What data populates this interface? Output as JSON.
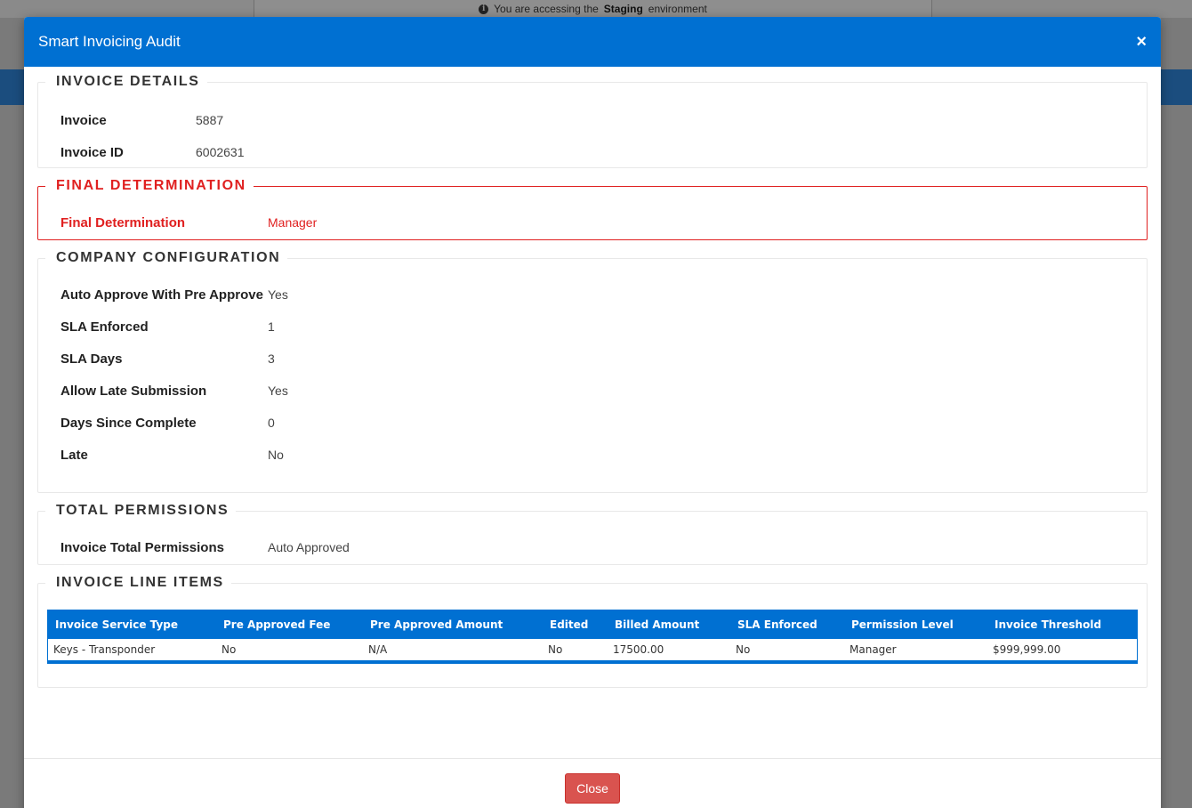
{
  "environment_banner": {
    "prefix": "You are accessing the",
    "env": "Staging",
    "suffix": "environment"
  },
  "modal": {
    "title": "Smart Invoicing Audit",
    "close_icon": "×",
    "close_button": "Close"
  },
  "invoice_details": {
    "legend": "INVOICE DETAILS",
    "rows": [
      {
        "label": "Invoice",
        "value": "5887"
      },
      {
        "label": "Invoice ID",
        "value": "6002631"
      }
    ]
  },
  "final_determination": {
    "legend": "FINAL DETERMINATION",
    "label": "Final Determination",
    "value": "Manager",
    "color": "#e02020"
  },
  "company_configuration": {
    "legend": "COMPANY CONFIGURATION",
    "rows": [
      {
        "label": "Auto Approve With Pre Approve",
        "value": "Yes"
      },
      {
        "label": "SLA Enforced",
        "value": "1"
      },
      {
        "label": "SLA Days",
        "value": "3"
      },
      {
        "label": "Allow Late Submission",
        "value": "Yes"
      },
      {
        "label": "Days Since Complete",
        "value": "0"
      },
      {
        "label": "Late",
        "value": "No"
      }
    ]
  },
  "total_permissions": {
    "legend": "TOTAL PERMISSIONS",
    "label": "Invoice Total Permissions",
    "value": "Auto Approved"
  },
  "line_items": {
    "legend": "INVOICE LINE ITEMS",
    "columns": [
      "Invoice Service Type",
      "Pre Approved Fee",
      "Pre Approved Amount",
      "Edited",
      "Billed Amount",
      "SLA Enforced",
      "Permission Level",
      "Invoice Threshold"
    ],
    "rows": [
      [
        "Keys - Transponder",
        "No",
        "N/A",
        "No",
        "17500.00",
        "No",
        "Manager",
        "$999,999.00"
      ]
    ]
  },
  "colors": {
    "primary": "#0070d2",
    "danger": "#e02020",
    "close_button": "#d9534f"
  }
}
